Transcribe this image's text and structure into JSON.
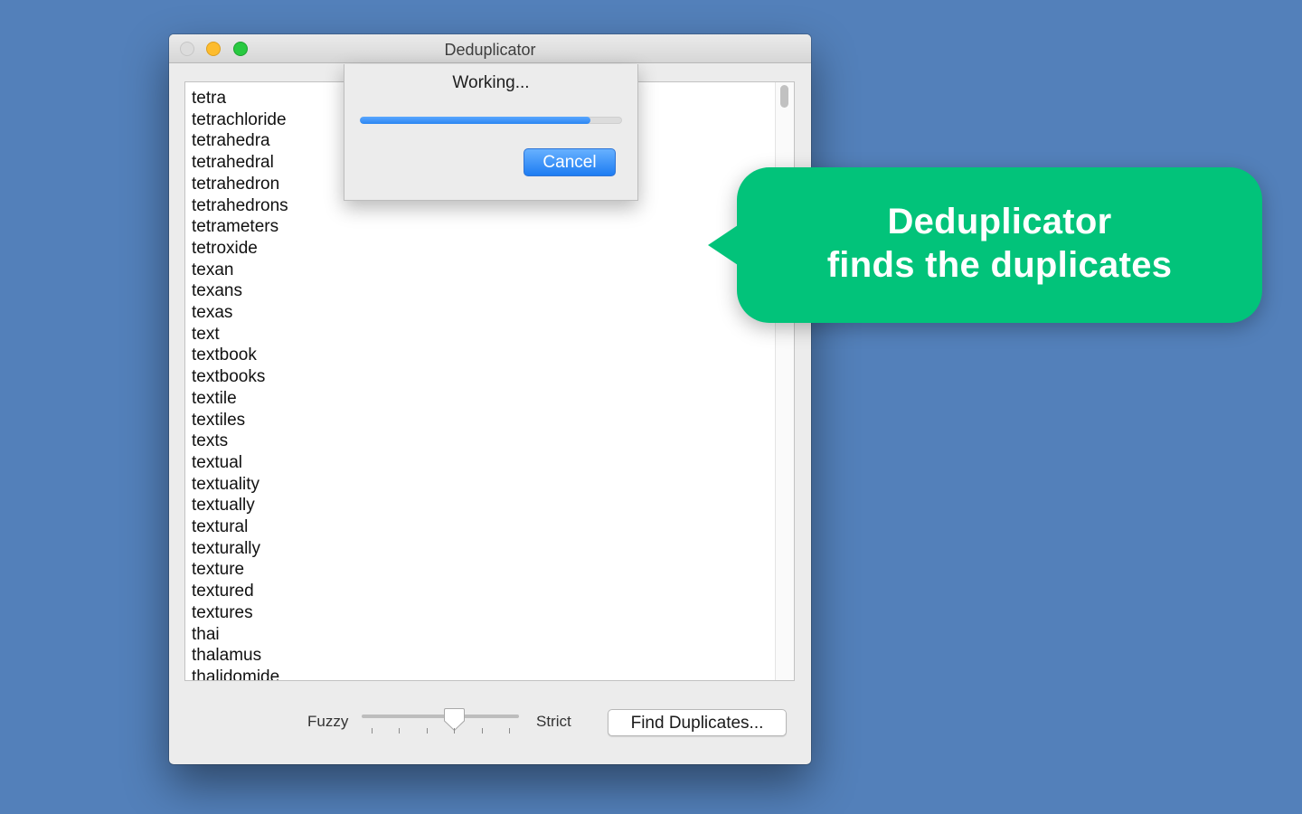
{
  "window": {
    "title": "Deduplicator",
    "traffic_lights": [
      "close",
      "minimize",
      "zoom"
    ]
  },
  "word_list": {
    "words": [
      "tetra",
      "tetrachloride",
      "tetrahedra",
      "tetrahedral",
      "tetrahedron",
      "tetrahedrons",
      "tetrameters",
      "tetroxide",
      "texan",
      "texans",
      "texas",
      "text",
      "textbook",
      "textbooks",
      "textile",
      "textiles",
      "texts",
      "textual",
      "textuality",
      "textually",
      "textural",
      "texturally",
      "texture",
      "textured",
      "textures",
      "thai",
      "thalamus",
      "thalidomide"
    ]
  },
  "progress_sheet": {
    "title": "Working...",
    "progress_fraction": 0.88,
    "cancel_label": "Cancel",
    "progress_color": "#2b86f2"
  },
  "controls": {
    "fuzzy_label": "Fuzzy",
    "strict_label": "Strict",
    "slider_tick_count": 6,
    "slider_value_fraction": 0.6,
    "find_button_label": "Find Duplicates..."
  },
  "callout": {
    "line1": "Deduplicator",
    "line2": "finds the duplicates",
    "color": "#02c37a"
  },
  "background_color": "#5380ba"
}
